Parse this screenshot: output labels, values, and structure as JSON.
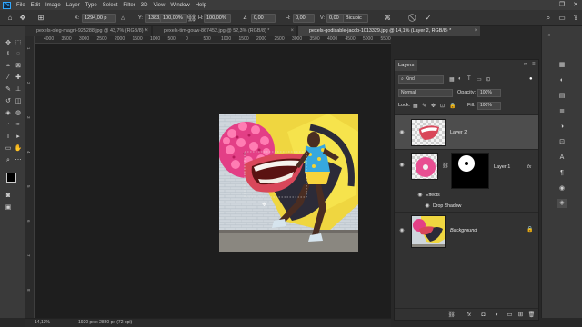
{
  "app": {
    "logo": "Ps",
    "menu": [
      "File",
      "Edit",
      "Image",
      "Layer",
      "Type",
      "Select",
      "Filter",
      "3D",
      "View",
      "Window",
      "Help"
    ],
    "window_controls": [
      "—",
      "❐",
      "✕"
    ]
  },
  "options_bar": {
    "x_label": "X:",
    "x_value": "1294,00 p",
    "y_label": "Y:",
    "y_value": "1383,00 p",
    "w_label": "W:",
    "w_value": "100,00%",
    "h_label": "H:",
    "h_value": "100,00%",
    "angle_label": "∠",
    "angle_value": "0,00",
    "h_skew_label": "H:",
    "h_skew_value": "0,00",
    "v_skew_label": "V:",
    "v_skew_value": "0,00",
    "interpolation": "Bicubic",
    "cancel_icon": "cancel-icon",
    "commit_icon": "commit-icon"
  },
  "tabs": [
    {
      "label": "pexels-oleg-magni-925288.jpg @ 43,7% (RGB/8) *",
      "active": false
    },
    {
      "label": "pexels-tim-gouw-867452.jpg @ 52,3% (RGB/8) *",
      "active": false
    },
    {
      "label": "pexels-godisable-jacob-1013329.jpg @ 14,1% (Layer 2, RGB/8) *",
      "active": true
    }
  ],
  "ruler": {
    "h_ticks": [
      "4000",
      "3500",
      "3000",
      "2500",
      "2000",
      "1500",
      "1000",
      "500",
      "0",
      "500",
      "1000",
      "1500",
      "2000",
      "2500",
      "3000",
      "3500",
      "4000",
      "4500",
      "5000",
      "5500"
    ],
    "v_ticks": [
      "1",
      "2",
      "3",
      "4",
      "5",
      "6",
      "7",
      "8"
    ]
  },
  "status_bar": {
    "zoom": "14,13%",
    "doc_size": "1920 px x 2880 px (72 ppi)"
  },
  "layers_panel": {
    "tab_label": "Layers",
    "filter_kind": "Kind",
    "blend_mode": "Normal",
    "opacity_label": "Opacity:",
    "opacity_value": "100%",
    "lock_label": "Lock:",
    "fill_label": "Fill:",
    "fill_value": "100%",
    "layers": [
      {
        "name": "Layer 2",
        "selected": true
      },
      {
        "name": "Layer 1",
        "selected": false,
        "fx": "fx"
      },
      {
        "name": "Effects",
        "sub": true
      },
      {
        "name": "Drop Shadow",
        "sub": true
      },
      {
        "name": "Background",
        "selected": false
      }
    ]
  },
  "colors": {
    "accent": "#31a8ff",
    "panel_bg": "#323232",
    "canvas_bg": "#1e1e1e"
  }
}
